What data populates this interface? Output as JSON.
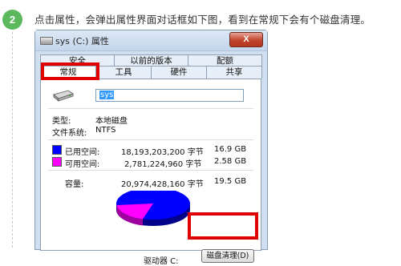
{
  "step": {
    "number": "2",
    "color": "#5cb85c"
  },
  "instruction": "点击属性，会弹出属性界面对话框如下图，看到在常规下会有个磁盘清理。",
  "dialog": {
    "title": "sys (C:) 属性",
    "close_label": "X",
    "tabs_row1": [
      "安全",
      "以前的版本",
      "配额"
    ],
    "tabs_row2": [
      "常规",
      "工具",
      "硬件",
      "共享"
    ],
    "active_tab": "常规",
    "drive_name": "sys",
    "type_label": "类型:",
    "type_value": "本地磁盘",
    "fs_label": "文件系统:",
    "fs_value": "NTFS",
    "used": {
      "label": "已用空间:",
      "bytes": "18,193,203,200 字节",
      "size": "16.9 GB",
      "color": "#0000ff"
    },
    "free": {
      "label": "可用空间:",
      "bytes": "2,781,224,960 字节",
      "size": "2.58 GB",
      "color": "#ff00ff"
    },
    "capacity": {
      "label": "容量:",
      "bytes": "20,974,428,160 字节",
      "size": "19.5 GB"
    },
    "drive_label": "驱动器 C:",
    "cleanup_button": "磁盘清理(D)",
    "highlight_color": "#e00000"
  }
}
